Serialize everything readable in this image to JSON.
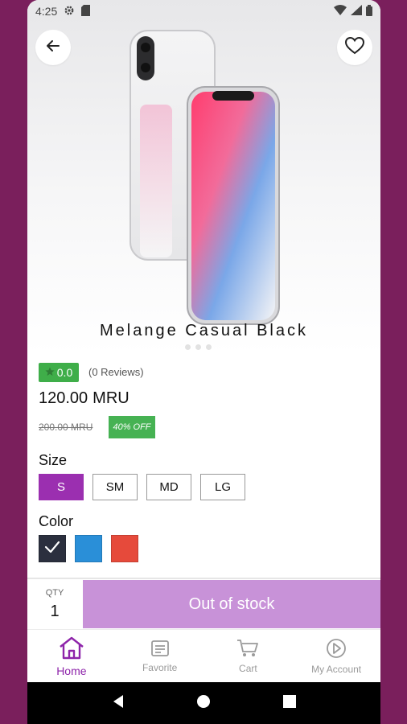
{
  "status_bar": {
    "time": "4:25"
  },
  "product": {
    "title": "Melange Casual Black",
    "rating": "0.0",
    "reviews": "(0 Reviews)",
    "price": "120.00",
    "currency": "MRU",
    "old_price": "200.00 MRU",
    "discount": "40% OFF"
  },
  "size_section": {
    "label": "Size",
    "options": [
      "S",
      "SM",
      "MD",
      "LG"
    ],
    "selected": "S"
  },
  "color_section": {
    "label": "Color",
    "swatches": [
      "#2b2f3e",
      "#2a8fd8",
      "#e64a3b"
    ],
    "selected_index": 0
  },
  "purchase_bar": {
    "qty_label": "QTY",
    "qty_value": "1",
    "button_label": "Out of stock"
  },
  "bottom_nav": {
    "items": [
      {
        "label": "Home",
        "icon": "home-icon"
      },
      {
        "label": "Favorite",
        "icon": "favorite-list-icon"
      },
      {
        "label": "Cart",
        "icon": "cart-icon"
      },
      {
        "label": "My Account",
        "icon": "account-icon"
      }
    ],
    "active_index": 0
  },
  "colors": {
    "frame": "#7a1f5c",
    "accent": "#9b2fb0",
    "rating_green": "#3fae49",
    "oos_button": "#c892d8"
  }
}
